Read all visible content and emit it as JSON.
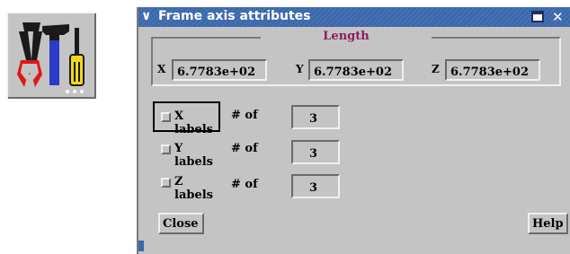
{
  "icon": {
    "name": "tools-icon"
  },
  "window": {
    "title": "Frame axis attributes",
    "menu_glyph": "∨",
    "close_glyph": "✕"
  },
  "length": {
    "label": "Length",
    "x": {
      "axis": "X",
      "value": "6.7783e+02"
    },
    "y": {
      "axis": "Y",
      "value": "6.7783e+02"
    },
    "z": {
      "axis": "Z",
      "value": "6.7783e+02"
    }
  },
  "labels": [
    {
      "label": "X labels",
      "checked": false,
      "of_label": "# of",
      "count": "3"
    },
    {
      "label": "Y labels",
      "checked": false,
      "of_label": "# of",
      "count": "3"
    },
    {
      "label": "Z labels",
      "checked": false,
      "of_label": "# of",
      "count": "3"
    }
  ],
  "buttons": {
    "close": "Close",
    "help": "Help"
  },
  "colors": {
    "title_bar": "#3c68ac",
    "panel": "#c4c4c4",
    "length_label": "#8a1c60"
  }
}
